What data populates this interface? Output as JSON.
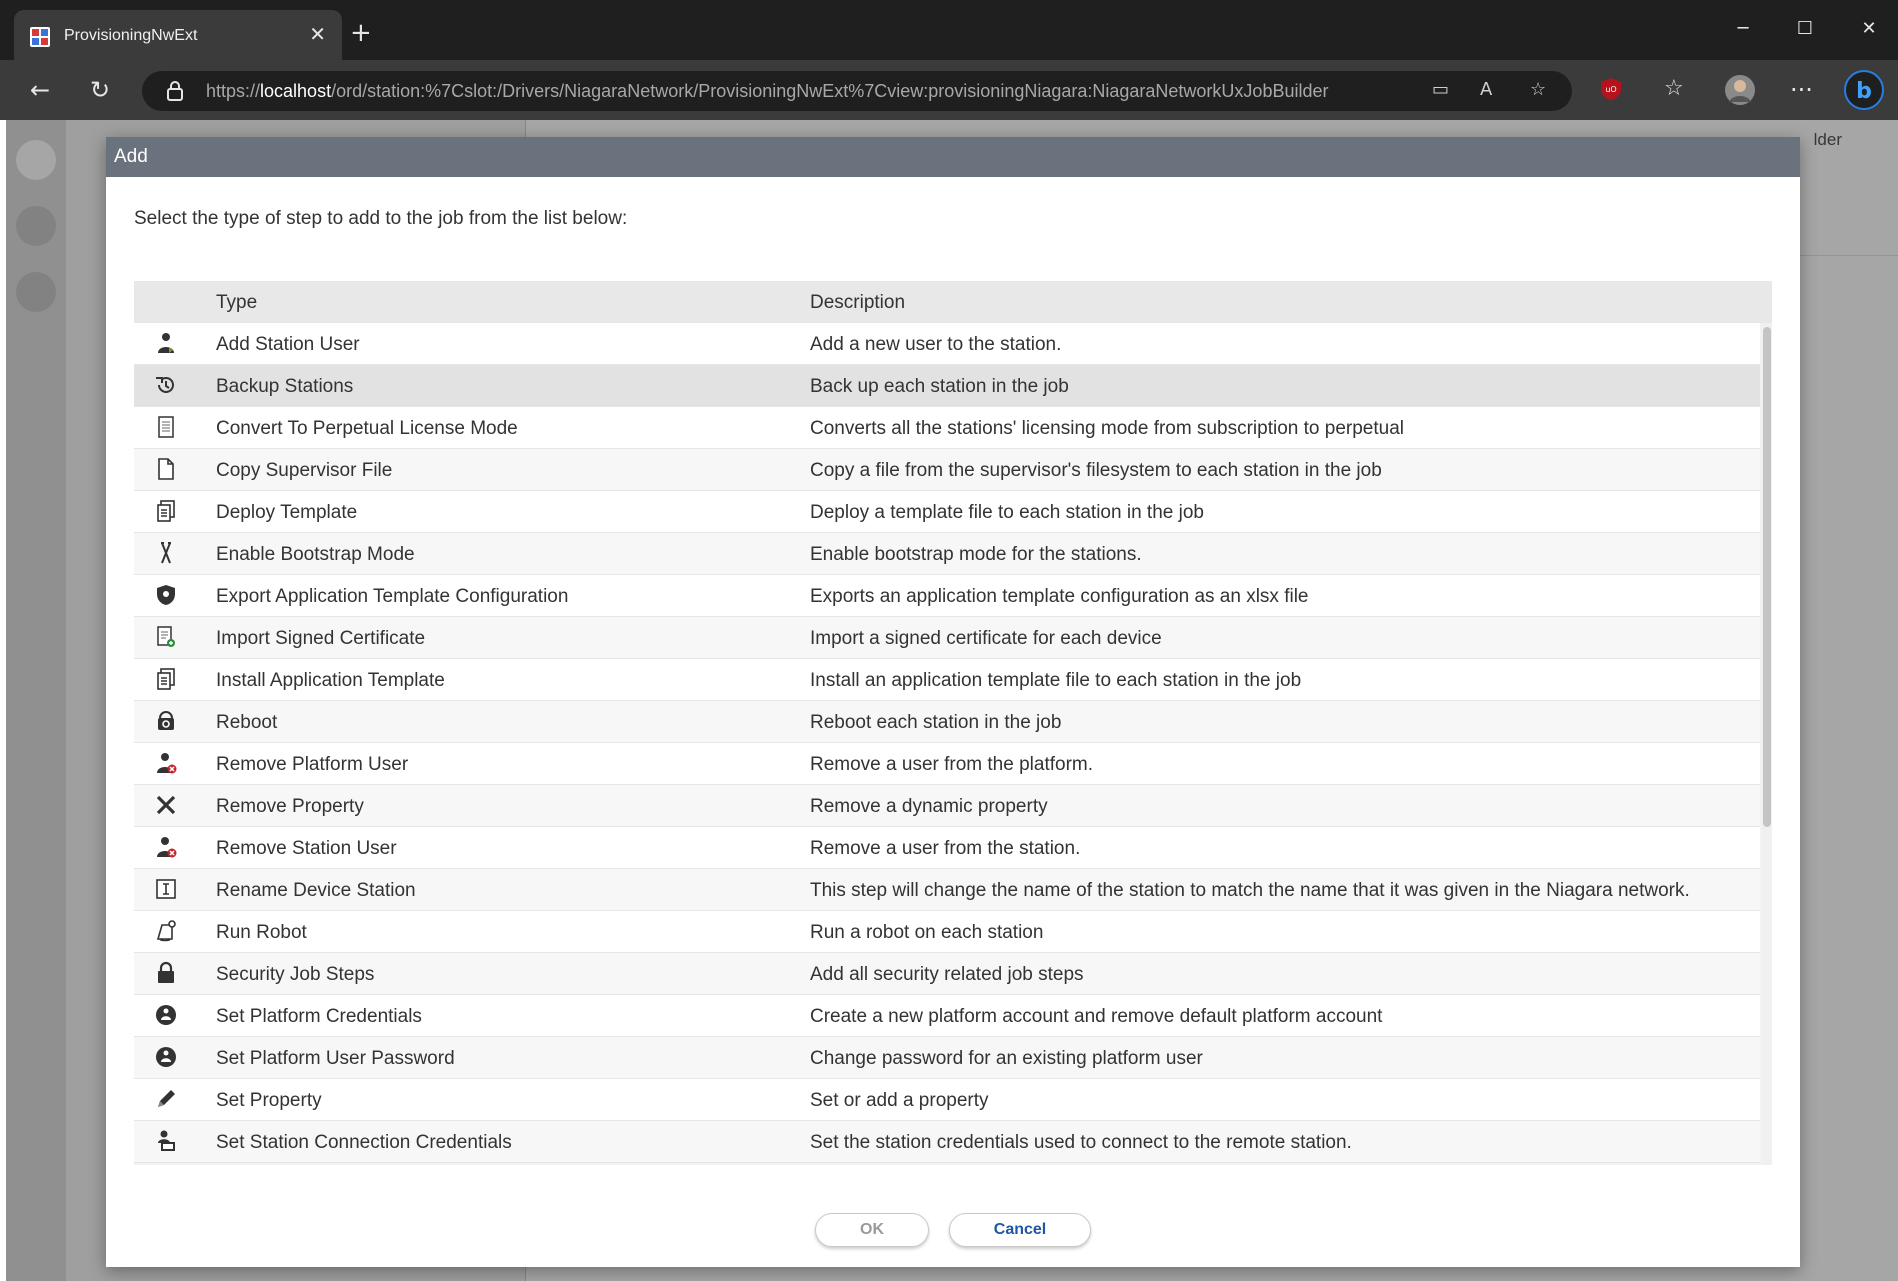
{
  "browser": {
    "tab_title": "ProvisioningNwExt",
    "url_scheme": "https://",
    "url_host": "localhost",
    "url_path": "/ord/station:%7Cslot:/Drivers/NiagaraNetwork/ProvisioningNwExt%7Cview:provisioningNiagara:NiagaraNetworkUxJobBuilder"
  },
  "background": {
    "builder_label": "lder"
  },
  "dialog": {
    "title": "Add",
    "instruction": "Select the type of step to add to the job from the list below:",
    "columns": {
      "type": "Type",
      "description": "Description"
    },
    "rows": [
      {
        "icon": "user-icon",
        "type": "Add Station User",
        "description": "Add a new user to the station."
      },
      {
        "icon": "history-icon",
        "type": "Backup Stations",
        "description": "Back up each station in the job"
      },
      {
        "icon": "document-lines-icon",
        "type": "Convert To Perpetual License Mode",
        "description": "Converts all the stations' licensing mode from subscription to perpetual"
      },
      {
        "icon": "file-icon",
        "type": "Copy Supervisor File",
        "description": "Copy a file from the supervisor's filesystem to each station in the job"
      },
      {
        "icon": "template-icon",
        "type": "Deploy Template",
        "description": "Deploy a template file to each station in the job"
      },
      {
        "icon": "bootstrap-icon",
        "type": "Enable Bootstrap Mode",
        "description": "Enable bootstrap mode for the stations."
      },
      {
        "icon": "shield-icon",
        "type": "Export Application Template Configuration",
        "description": "Exports an application template configuration as an xlsx file"
      },
      {
        "icon": "certificate-import-icon",
        "type": "Import Signed Certificate",
        "description": "Import a signed certificate for each device"
      },
      {
        "icon": "template-icon",
        "type": "Install Application Template",
        "description": "Install an application template file to each station in the job"
      },
      {
        "icon": "reboot-icon",
        "type": "Reboot",
        "description": "Reboot each station in the job"
      },
      {
        "icon": "user-remove-icon",
        "type": "Remove Platform User",
        "description": "Remove a user from the platform."
      },
      {
        "icon": "close-x-icon",
        "type": "Remove Property",
        "description": "Remove a dynamic property"
      },
      {
        "icon": "user-remove-icon",
        "type": "Remove Station User",
        "description": "Remove a user from the station."
      },
      {
        "icon": "rename-icon",
        "type": "Rename Device Station",
        "description": "This step will change the name of the station to match the name that it was given in the Niagara network."
      },
      {
        "icon": "robot-icon",
        "type": "Run Robot",
        "description": "Run a robot on each station"
      },
      {
        "icon": "lock-icon",
        "type": "Security Job Steps",
        "description": "Add all security related job steps"
      },
      {
        "icon": "info-user-icon",
        "type": "Set Platform Credentials",
        "description": "Create a new platform account and remove default platform account"
      },
      {
        "icon": "info-user-icon",
        "type": "Set Platform User Password",
        "description": "Change password for an existing platform user"
      },
      {
        "icon": "pencil-icon",
        "type": "Set Property",
        "description": "Set or add a property"
      },
      {
        "icon": "user-credentials-icon",
        "type": "Set Station Connection Credentials",
        "description": "Set the station credentials used to connect to the remote station."
      }
    ],
    "selected_row": 1,
    "ok_label": "OK",
    "cancel_label": "Cancel"
  }
}
